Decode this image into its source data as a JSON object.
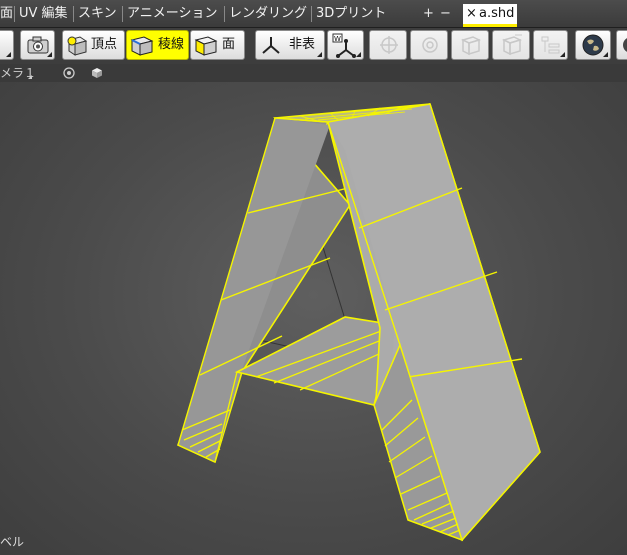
{
  "tabbar": {
    "menus": [
      {
        "label": "面"
      },
      {
        "label": "UV 編集"
      },
      {
        "label": "スキン"
      },
      {
        "label": "アニメーション"
      },
      {
        "label": "レンダリング"
      },
      {
        "label": "3Dプリント"
      }
    ],
    "add_label": "+",
    "remove_label": "−",
    "document_tab": {
      "close_label": "×",
      "name": "a.shd"
    }
  },
  "toolbar": {
    "vertex_label": "頂点",
    "edge_label": "稜線",
    "face_label": "面",
    "hide_label": "非表"
  },
  "view": {
    "camera_label": "メラ１",
    "corner_label": "ベル"
  },
  "colors": {
    "selection": "#ffff00",
    "selected_mode": "#ffff00",
    "face": "#a9a9a9"
  }
}
